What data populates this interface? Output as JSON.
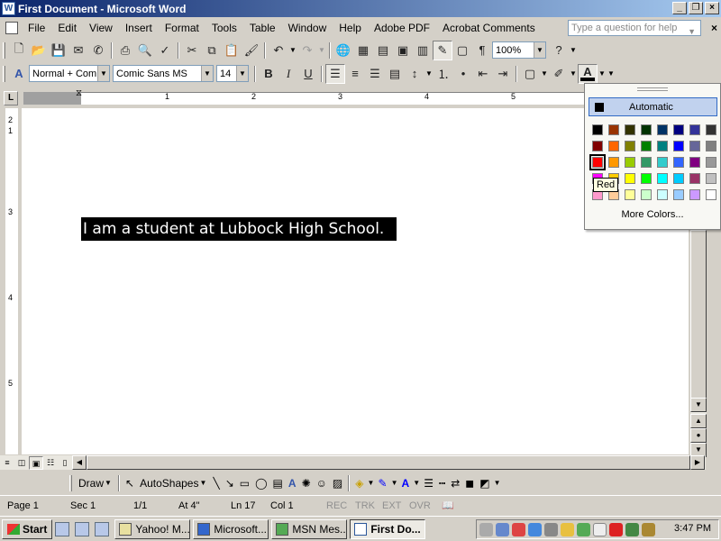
{
  "window": {
    "title": "First Document - Microsoft Word"
  },
  "menubar": {
    "items": [
      "File",
      "Edit",
      "View",
      "Insert",
      "Format",
      "Tools",
      "Table",
      "Window",
      "Help",
      "Adobe PDF",
      "Acrobat Comments"
    ],
    "help_placeholder": "Type a question for help"
  },
  "standard_toolbar": {
    "zoom": "100%"
  },
  "formatting_toolbar": {
    "style": "Normal + Comic",
    "font": "Comic Sans MS",
    "size": "14"
  },
  "ruler": {
    "numbers": [
      "1",
      "2",
      "3",
      "4",
      "5"
    ],
    "side_numbers": [
      "2",
      "1",
      "3",
      "4",
      "5"
    ]
  },
  "document": {
    "text": "I am a student at Lubbock High School."
  },
  "font_color_panel": {
    "automatic_label": "Automatic",
    "more_colors_label": "More Colors...",
    "tooltip": "Red",
    "colors": [
      "#000000",
      "#993300",
      "#333300",
      "#003300",
      "#003366",
      "#000080",
      "#333399",
      "#333333",
      "#800000",
      "#ff6600",
      "#808000",
      "#008000",
      "#008080",
      "#0000ff",
      "#666699",
      "#808080",
      "#ff0000",
      "#ff9900",
      "#99cc00",
      "#339966",
      "#33cccc",
      "#3366ff",
      "#800080",
      "#999999",
      "#ff00ff",
      "#ffcc00",
      "#ffff00",
      "#00ff00",
      "#00ffff",
      "#00ccff",
      "#993366",
      "#c0c0c0",
      "#ff99cc",
      "#ffcc99",
      "#ffff99",
      "#ccffcc",
      "#ccffff",
      "#99ccff",
      "#cc99ff",
      "#ffffff"
    ],
    "selected_index": 16
  },
  "drawing_toolbar": {
    "draw_label": "Draw",
    "autoshapes_label": "AutoShapes"
  },
  "statusbar": {
    "page": "Page 1",
    "section": "Sec 1",
    "pages": "1/1",
    "at": "At 4\"",
    "line": "Ln 17",
    "col": "Col 1",
    "rec": "REC",
    "trk": "TRK",
    "ext": "EXT",
    "ovr": "OVR"
  },
  "taskbar": {
    "start_label": "Start",
    "tasks": [
      {
        "label": "Yahoo! M...",
        "active": false
      },
      {
        "label": "Microsoft...",
        "active": false
      },
      {
        "label": "MSN Mes...",
        "active": false
      },
      {
        "label": "First Do...",
        "active": true
      }
    ],
    "clock": "3:47 PM"
  }
}
